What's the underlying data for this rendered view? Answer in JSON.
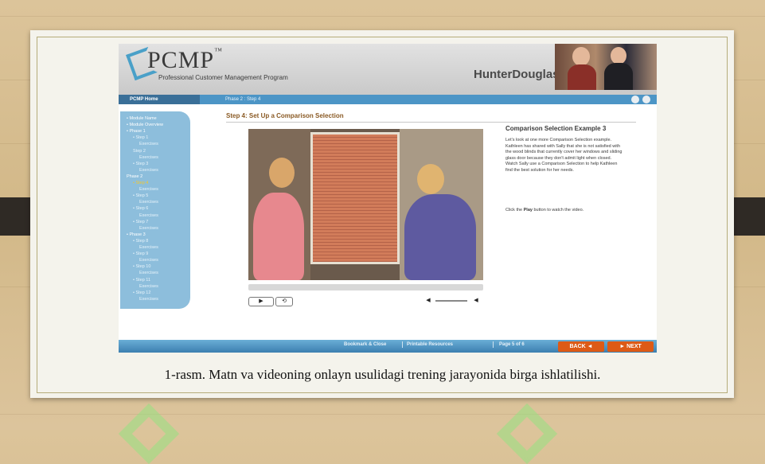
{
  "app": {
    "logo_title": "PCMP",
    "logo_tm": "™",
    "logo_subtitle": "Professional Customer Management Program",
    "brand": "HunterDouglas"
  },
  "nav": {
    "home_label": "PCMP Home",
    "phase_step": "Phase 2 : Step 4"
  },
  "sidebar": {
    "items": [
      {
        "label": "• Module Name",
        "level": 0
      },
      {
        "label": "• Module Overview",
        "level": 0
      },
      {
        "label": "• Phase 1",
        "level": 0
      },
      {
        "label": "• Step 1",
        "level": 1
      },
      {
        "label": "Exercises",
        "level": 2
      },
      {
        "label": "Step 2",
        "level": 1
      },
      {
        "label": "Exercises",
        "level": 2
      },
      {
        "label": "• Step 3",
        "level": 1
      },
      {
        "label": "Exercises",
        "level": 2
      },
      {
        "label": "Phase 2",
        "level": 0
      },
      {
        "label": "• Step 4",
        "level": 1,
        "active": true
      },
      {
        "label": "Exercises",
        "level": 2
      },
      {
        "label": "• Step 5",
        "level": 1
      },
      {
        "label": "Exercises",
        "level": 2
      },
      {
        "label": "• Step 6",
        "level": 1
      },
      {
        "label": "Exercises",
        "level": 2
      },
      {
        "label": "• Step 7",
        "level": 1
      },
      {
        "label": "Exercises",
        "level": 2
      },
      {
        "label": "• Phase 3",
        "level": 0
      },
      {
        "label": "• Step 8",
        "level": 1
      },
      {
        "label": "Exercises",
        "level": 2
      },
      {
        "label": "• Step 9",
        "level": 1
      },
      {
        "label": "Exercises",
        "level": 2
      },
      {
        "label": "• Step 10",
        "level": 1
      },
      {
        "label": "Exercises",
        "level": 2
      },
      {
        "label": "• Step 11",
        "level": 1
      },
      {
        "label": "Exercises",
        "level": 2
      },
      {
        "label": "• Step 12",
        "level": 1
      },
      {
        "label": "Exercises",
        "level": 2
      }
    ]
  },
  "main": {
    "step_title": "Step 4: Set Up a Comparison Selection",
    "example_title": "Comparison Selection Example 3",
    "example_text": "Let's look at one more Comparison Selection example. Kathleen has shared with Sally that she is not satisfied with the wood blinds that currently cover her windows and sliding glass door because they don't admit light when closed. Watch Sally use a Comparison Selection to help Kathleen find the best solution for her needs.",
    "example_instruction_pre": "Click the ",
    "example_instruction_bold": "Play",
    "example_instruction_post": " button to watch the video."
  },
  "video": {
    "progress": 0.0
  },
  "footer": {
    "bookmark_label": "Bookmark & Close",
    "resources_label": "Printable Resources",
    "page_label": "Page 5 of 6",
    "back_label": "BACK ◄",
    "next_label": "► NEXT"
  },
  "caption": "1-rasm. Matn va videoning onlayn usulidagi trening jarayonida birga ishlatilishi.",
  "colors": {
    "nav_blue": "#4c95c6",
    "sidebar_blue": "#8dbedc",
    "button_orange": "#dd5a16",
    "active_step": "#f3c72f"
  }
}
